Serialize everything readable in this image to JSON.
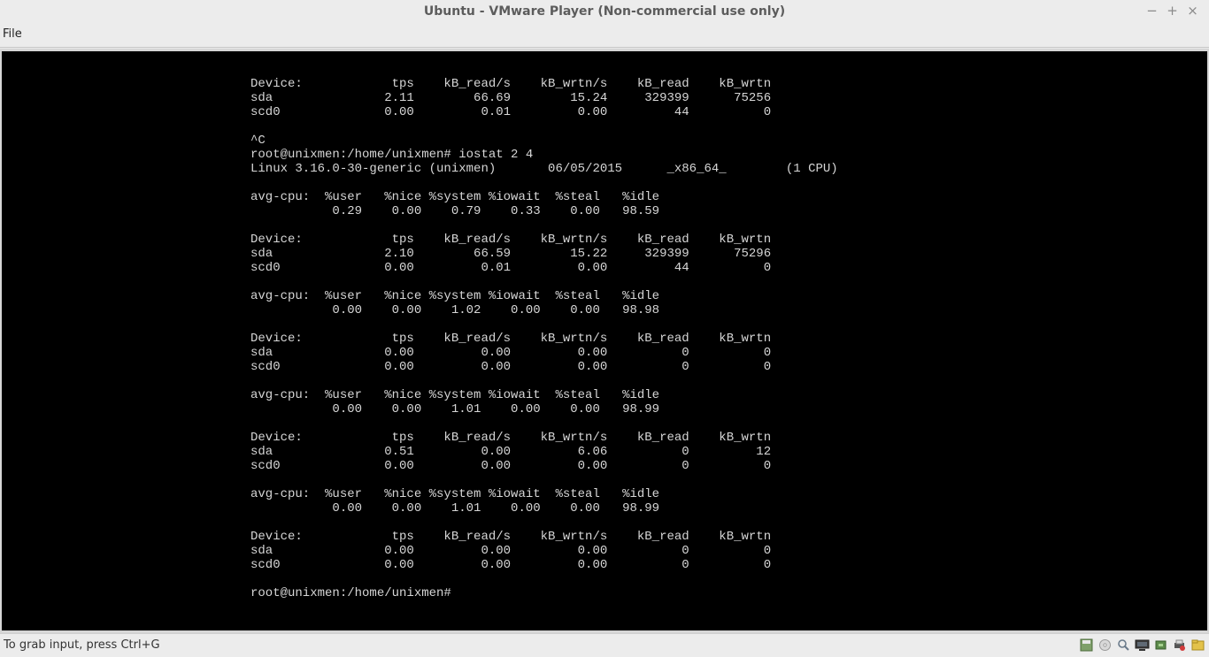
{
  "window": {
    "title": "Ubuntu - VMware Player (Non-commercial use only)",
    "minimize": "−",
    "maximize": "+",
    "close": "×"
  },
  "menu": {
    "file": "File"
  },
  "terminal": {
    "lines": [
      "Device:            tps    kB_read/s    kB_wrtn/s    kB_read    kB_wrtn",
      "sda               2.11        66.69        15.24     329399      75256",
      "scd0              0.00         0.01         0.00         44          0",
      "",
      "^C",
      "root@unixmen:/home/unixmen# iostat 2 4",
      "Linux 3.16.0-30-generic (unixmen)       06/05/2015      _x86_64_        (1 CPU)",
      "",
      "avg-cpu:  %user   %nice %system %iowait  %steal   %idle",
      "           0.29    0.00    0.79    0.33    0.00   98.59",
      "",
      "Device:            tps    kB_read/s    kB_wrtn/s    kB_read    kB_wrtn",
      "sda               2.10        66.59        15.22     329399      75296",
      "scd0              0.00         0.01         0.00         44          0",
      "",
      "avg-cpu:  %user   %nice %system %iowait  %steal   %idle",
      "           0.00    0.00    1.02    0.00    0.00   98.98",
      "",
      "Device:            tps    kB_read/s    kB_wrtn/s    kB_read    kB_wrtn",
      "sda               0.00         0.00         0.00          0          0",
      "scd0              0.00         0.00         0.00          0          0",
      "",
      "avg-cpu:  %user   %nice %system %iowait  %steal   %idle",
      "           0.00    0.00    1.01    0.00    0.00   98.99",
      "",
      "Device:            tps    kB_read/s    kB_wrtn/s    kB_read    kB_wrtn",
      "sda               0.51         0.00         6.06          0         12",
      "scd0              0.00         0.00         0.00          0          0",
      "",
      "avg-cpu:  %user   %nice %system %iowait  %steal   %idle",
      "           0.00    0.00    1.01    0.00    0.00   98.99",
      "",
      "Device:            tps    kB_read/s    kB_wrtn/s    kB_read    kB_wrtn",
      "sda               0.00         0.00         0.00          0          0",
      "scd0              0.00         0.00         0.00          0          0",
      "",
      "root@unixmen:/home/unixmen#"
    ]
  },
  "status": {
    "text": "To grab input, press Ctrl+G",
    "tray_icons": [
      "floppy-icon",
      "cdrom-icon",
      "sound-icon",
      "network-icon",
      "usb-icon",
      "printer-icon",
      "folder-icon"
    ]
  }
}
